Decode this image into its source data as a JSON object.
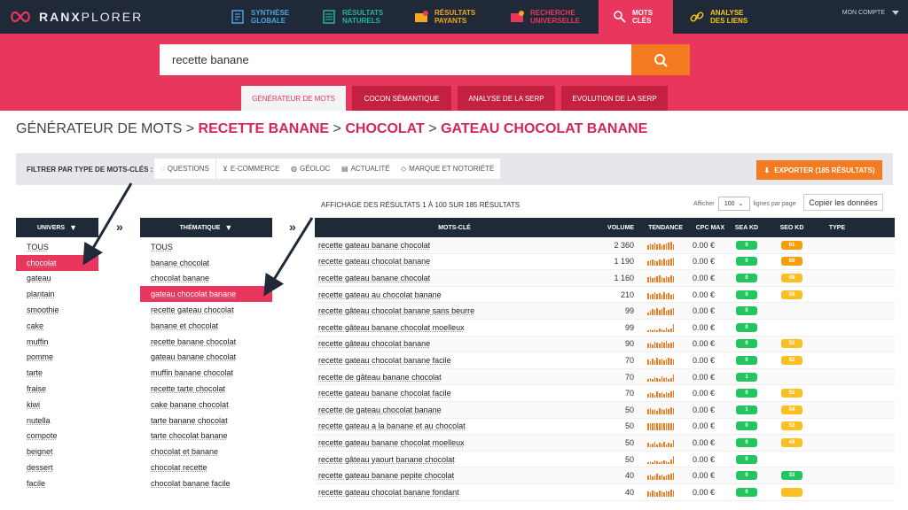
{
  "brand": {
    "name_bold": "RANX",
    "name_light": "PLORER"
  },
  "nav": [
    {
      "label": "Synthèse\nglobale",
      "icon": "report-icon",
      "color": "#4aa3df"
    },
    {
      "label": "Résultats\nnaturels",
      "icon": "list-icon",
      "color": "#1fb5a3"
    },
    {
      "label": "Résultats\npayants",
      "icon": "paid-icon",
      "color": "#f5a623"
    },
    {
      "label": "Recherche\nuniverselle",
      "icon": "universal-icon",
      "color": "#e8365d"
    },
    {
      "label": "Mots\nclés",
      "icon": "key-icon",
      "color": "#ffffff"
    },
    {
      "label": "Analyse\ndes liens",
      "icon": "link-icon",
      "color": "#f5c518"
    }
  ],
  "account": "MON COMPTE",
  "search": {
    "value": "recette banane"
  },
  "subtabs": [
    "GÉNÉRATEUR DE MOTS",
    "COCON SÉMANTIQUE",
    "ANALYSE DE LA SERP",
    "EVOLUTION DE LA SERP"
  ],
  "breadcrumb": {
    "root": "GÉNÉRATEUR DE MOTS",
    "sep": ">",
    "items": [
      "RECETTE BANANE",
      "CHOCOLAT",
      "GATEAU CHOCOLAT BANANE"
    ]
  },
  "filters": {
    "label": "FILTRER PAR TYPE DE MOTS-CLÉS :",
    "chips": [
      "QUESTIONS",
      "E-COMMERCE",
      "GÉOLOC",
      "ACTUALITÉ",
      "MARQUE ET NOTORIÉTÉ"
    ]
  },
  "export_label": "EXPORTER (185 RÉSULTATS)",
  "univers": {
    "header": "UNIVERS",
    "items": [
      "TOUS",
      "chocolat",
      "gateau",
      "plantain",
      "smoothie",
      "cake",
      "muffin",
      "pomme",
      "tarte",
      "fraise",
      "kiwi",
      "nutella",
      "compote",
      "beignet",
      "dessert",
      "facile"
    ],
    "selected": 1
  },
  "thematique": {
    "header": "THÉMATIQUE",
    "items": [
      "TOUS",
      "banane chocolat",
      "chocolat banane",
      "gateau chocolat banane",
      "recette gateau chocolat",
      "banane et chocolat",
      "recette banane chocolat",
      "gateau banane chocolat",
      "muffin banane chocolat",
      "recette tarte chocolat",
      "cake banane chocolat",
      "tarte banane chocolat",
      "tarte chocolat banane",
      "chocolat et banane",
      "chocolat recette",
      "chocolat banane facile"
    ],
    "selected": 3
  },
  "results": {
    "info": "AFFICHAGE DES RÉSULTATS 1 À 100 SUR 185 RÉSULTATS",
    "per_page_prefix": "Afficher",
    "per_page_value": "100",
    "per_page_suffix": "lignes par page",
    "copy_label": "Copier les données",
    "columns": [
      "MOTS-CLÉ",
      "VOLUME",
      "TENDANCE",
      "CPC MAX",
      "SEA KD",
      "SEO KD",
      "TYPE"
    ],
    "rows": [
      {
        "kw": "recette gateau banane chocolat",
        "vol": "2 360",
        "cpc": "0.00 €",
        "sea": "0",
        "seo": "61",
        "seo_color": "orange",
        "trend": [
          5,
          7,
          6,
          8,
          6,
          7,
          5,
          6,
          7,
          8,
          9,
          6
        ]
      },
      {
        "kw": "recette gateau chocolat banane",
        "vol": "1 190",
        "cpc": "0.00 €",
        "sea": "0",
        "seo": "68",
        "seo_color": "orange",
        "trend": [
          5,
          6,
          7,
          6,
          5,
          7,
          6,
          8,
          6,
          7,
          8,
          9
        ]
      },
      {
        "kw": "recette gateau banane chocolat",
        "vol": "1 160",
        "cpc": "0.00 €",
        "sea": "0",
        "seo": "48",
        "seo_color": "yellow",
        "trend": [
          6,
          7,
          5,
          6,
          7,
          8,
          6,
          5,
          7,
          6,
          8,
          7
        ]
      },
      {
        "kw": "recette gateau au chocolat banane",
        "vol": "210",
        "cpc": "0.00 €",
        "sea": "0",
        "seo": "58",
        "seo_color": "yellow",
        "trend": [
          7,
          5,
          6,
          8,
          6,
          7,
          5,
          8,
          6,
          7,
          5,
          6
        ]
      },
      {
        "kw": "recette gâteau chocolat banane sans beurre",
        "vol": "99",
        "cpc": "0.00 €",
        "sea": "0",
        "seo": "",
        "seo_color": "",
        "trend": [
          3,
          5,
          7,
          6,
          8,
          6,
          7,
          9,
          5,
          6,
          7,
          8
        ]
      },
      {
        "kw": "recette gâteau banane chocolat moelleux",
        "vol": "99",
        "cpc": "0.00 €",
        "sea": "0",
        "seo": "",
        "seo_color": "",
        "trend": [
          2,
          3,
          2,
          3,
          2,
          4,
          3,
          2,
          5,
          3,
          4,
          9
        ]
      },
      {
        "kw": "recette gâteau chocolat banane",
        "vol": "90",
        "cpc": "0.00 €",
        "sea": "0",
        "seo": "52",
        "seo_color": "yellow",
        "trend": [
          5,
          6,
          4,
          7,
          6,
          5,
          7,
          6,
          8,
          5,
          6,
          7
        ]
      },
      {
        "kw": "recette gateau chocolat banane facile",
        "vol": "70",
        "cpc": "0.00 €",
        "sea": "0",
        "seo": "52",
        "seo_color": "yellow",
        "trend": [
          6,
          4,
          7,
          5,
          8,
          6,
          7,
          5,
          6,
          8,
          7,
          6
        ]
      },
      {
        "kw": "recette de gâteau banane chocolat",
        "vol": "70",
        "cpc": "0.00 €",
        "sea": "1",
        "seo": "",
        "seo_color": "",
        "trend": [
          3,
          4,
          3,
          5,
          4,
          3,
          6,
          4,
          5,
          3,
          4,
          8
        ]
      },
      {
        "kw": "recette gateau banane chocolat facile",
        "vol": "70",
        "cpc": "0.00 €",
        "sea": "0",
        "seo": "55",
        "seo_color": "yellow",
        "trend": [
          4,
          6,
          5,
          3,
          7,
          5,
          6,
          4,
          6,
          5,
          7,
          8
        ]
      },
      {
        "kw": "recette de gateau chocolat banane",
        "vol": "50",
        "cpc": "0.00 €",
        "sea": "1",
        "seo": "54",
        "seo_color": "yellow",
        "trend": [
          6,
          7,
          5,
          6,
          4,
          7,
          6,
          5,
          7,
          6,
          8,
          7
        ]
      },
      {
        "kw": "recette gateau a la banane et au chocolat",
        "vol": "50",
        "cpc": "0.00 €",
        "sea": "0",
        "seo": "52",
        "seo_color": "yellow",
        "trend": [
          8,
          8,
          8,
          8,
          8,
          8,
          8,
          8,
          8,
          8,
          8,
          8
        ]
      },
      {
        "kw": "recette gateau banane chocolat moelleux",
        "vol": "50",
        "cpc": "0.00 €",
        "sea": "0",
        "seo": "49",
        "seo_color": "yellow",
        "trend": [
          5,
          3,
          4,
          6,
          3,
          5,
          4,
          6,
          3,
          5,
          4,
          8
        ]
      },
      {
        "kw": "recette gâteau yaourt banane chocolat",
        "vol": "50",
        "cpc": "0.00 €",
        "sea": "0",
        "seo": "",
        "seo_color": "",
        "trend": [
          2,
          3,
          2,
          4,
          3,
          2,
          3,
          4,
          3,
          2,
          5,
          9
        ]
      },
      {
        "kw": "recette gateau banane pepite chocolat",
        "vol": "40",
        "cpc": "0.00 €",
        "sea": "0",
        "seo": "33",
        "seo_color": "green",
        "trend": [
          5,
          6,
          4,
          5,
          7,
          5,
          6,
          4,
          5,
          6,
          7,
          8
        ]
      },
      {
        "kw": "recette gateau chocolat banane fondant",
        "vol": "40",
        "cpc": "0.00 €",
        "sea": "0",
        "seo": "",
        "seo_color": "yellow",
        "trend": [
          6,
          5,
          7,
          6,
          5,
          7,
          6,
          5,
          7,
          6,
          8,
          7
        ]
      }
    ]
  }
}
